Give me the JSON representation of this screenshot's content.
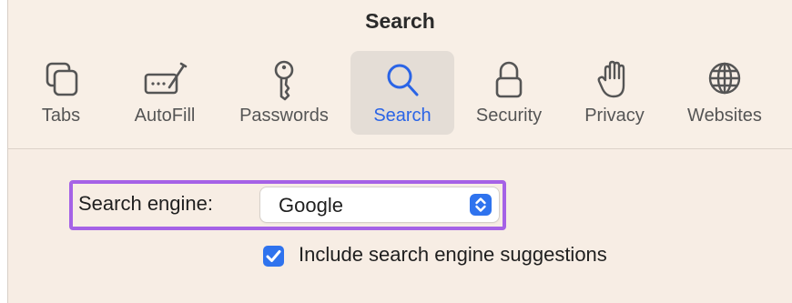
{
  "window": {
    "title": "Search"
  },
  "toolbar": {
    "tabs": [
      {
        "label": "Tabs",
        "icon": "tabs-icon",
        "selected": false
      },
      {
        "label": "AutoFill",
        "icon": "autofill-icon",
        "selected": false
      },
      {
        "label": "Passwords",
        "icon": "key-icon",
        "selected": false
      },
      {
        "label": "Search",
        "icon": "magnifier-icon",
        "selected": true
      },
      {
        "label": "Security",
        "icon": "lock-icon",
        "selected": false
      },
      {
        "label": "Privacy",
        "icon": "hand-icon",
        "selected": false
      },
      {
        "label": "Websites",
        "icon": "globe-icon",
        "selected": false
      }
    ]
  },
  "search_settings": {
    "engine_label": "Search engine:",
    "engine_value": "Google",
    "suggestions_label": "Include search engine suggestions",
    "suggestions_checked": true
  },
  "colors": {
    "accent": "#2f73ee",
    "selected_text": "#2a64e6",
    "highlight_outline": "#a562e6",
    "background": "#f7ede4"
  }
}
